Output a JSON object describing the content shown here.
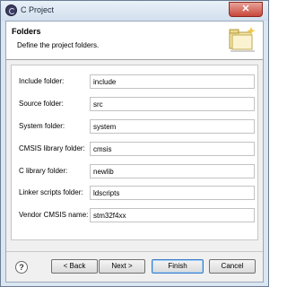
{
  "window": {
    "title": "C Project",
    "close_glyph": "✕"
  },
  "header": {
    "title": "Folders",
    "description": "Define the project folders."
  },
  "fields": [
    {
      "label": "Include folder:",
      "value": "include"
    },
    {
      "label": "Source folder:",
      "value": "src"
    },
    {
      "label": "System folder:",
      "value": "system"
    },
    {
      "label": "CMSIS library folder:",
      "value": "cmsis"
    },
    {
      "label": "C library folder:",
      "value": "newlib"
    },
    {
      "label": "Linker scripts folder:",
      "value": "ldscripts"
    },
    {
      "label": "Vendor CMSIS name:",
      "value": "stm32f4xx"
    }
  ],
  "footer": {
    "help_glyph": "?",
    "back_label": "< Back",
    "next_label": "Next >",
    "finish_label": "Finish",
    "cancel_label": "Cancel"
  },
  "icons": {
    "app": "eclipse-icon",
    "wizard": "folder-wizard-icon",
    "help": "help-icon",
    "close": "close-icon"
  },
  "colors": {
    "titlebar": "#d2dfee",
    "close": "#c8473a",
    "default_button_border": "#3a7bc8"
  }
}
